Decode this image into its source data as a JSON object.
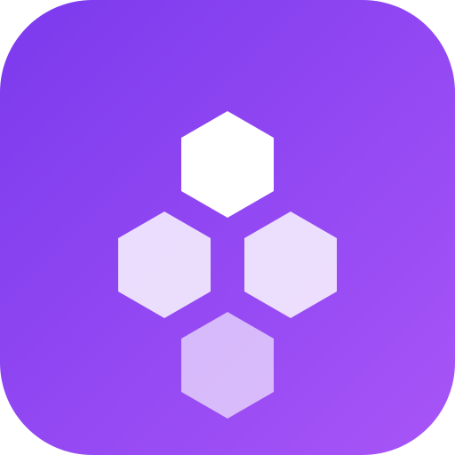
{
  "icon": {
    "name": "hexagon-cluster-app-icon",
    "background": {
      "gradient_start": "#7B3AED",
      "gradient_end": "#A855F7"
    },
    "hexagons": [
      {
        "name": "hexagon-top",
        "color": "#FFFFFF",
        "opacity": 1.0
      },
      {
        "name": "hexagon-middle-left",
        "color": "#FFFFFF",
        "opacity": 0.82
      },
      {
        "name": "hexagon-middle-right",
        "color": "#FFFFFF",
        "opacity": 0.82
      },
      {
        "name": "hexagon-bottom",
        "color": "#FFFFFF",
        "opacity": 0.62
      }
    ]
  }
}
